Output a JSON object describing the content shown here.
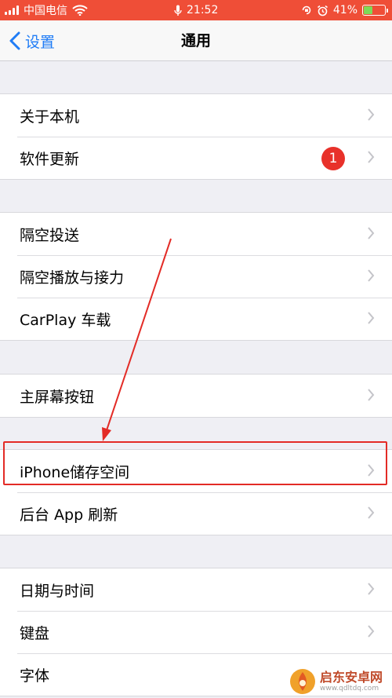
{
  "status_bar": {
    "carrier": "中国电信",
    "time": "21:52",
    "battery_percent": "41%",
    "battery_level": 0.41,
    "icons": [
      "signal-icon",
      "wifi-icon",
      "microphone-icon",
      "rotation-lock-icon",
      "alarm-icon",
      "battery-icon"
    ],
    "bg_color": "#ef4e37"
  },
  "nav_bar": {
    "back_label": "设置",
    "title": "通用",
    "accent_color": "#1f7cf6"
  },
  "groups": [
    {
      "items": [
        {
          "label": "关于本机"
        },
        {
          "label": "软件更新",
          "badge": "1"
        }
      ]
    },
    {
      "items": [
        {
          "label": "隔空投送"
        },
        {
          "label": "隔空播放与接力"
        },
        {
          "label": "CarPlay 车载"
        }
      ]
    },
    {
      "items": [
        {
          "label": "主屏幕按钮"
        }
      ]
    },
    {
      "items": [
        {
          "label": "iPhone储存空间",
          "highlighted": true
        },
        {
          "label": "后台 App 刷新"
        }
      ]
    },
    {
      "items": [
        {
          "label": "日期与时间"
        },
        {
          "label": "键盘"
        },
        {
          "label": "字体"
        }
      ]
    }
  ],
  "annotation": {
    "color": "#e32b26"
  },
  "watermark": {
    "title": "启东安卓网",
    "url": "www.qdltdq.com"
  }
}
